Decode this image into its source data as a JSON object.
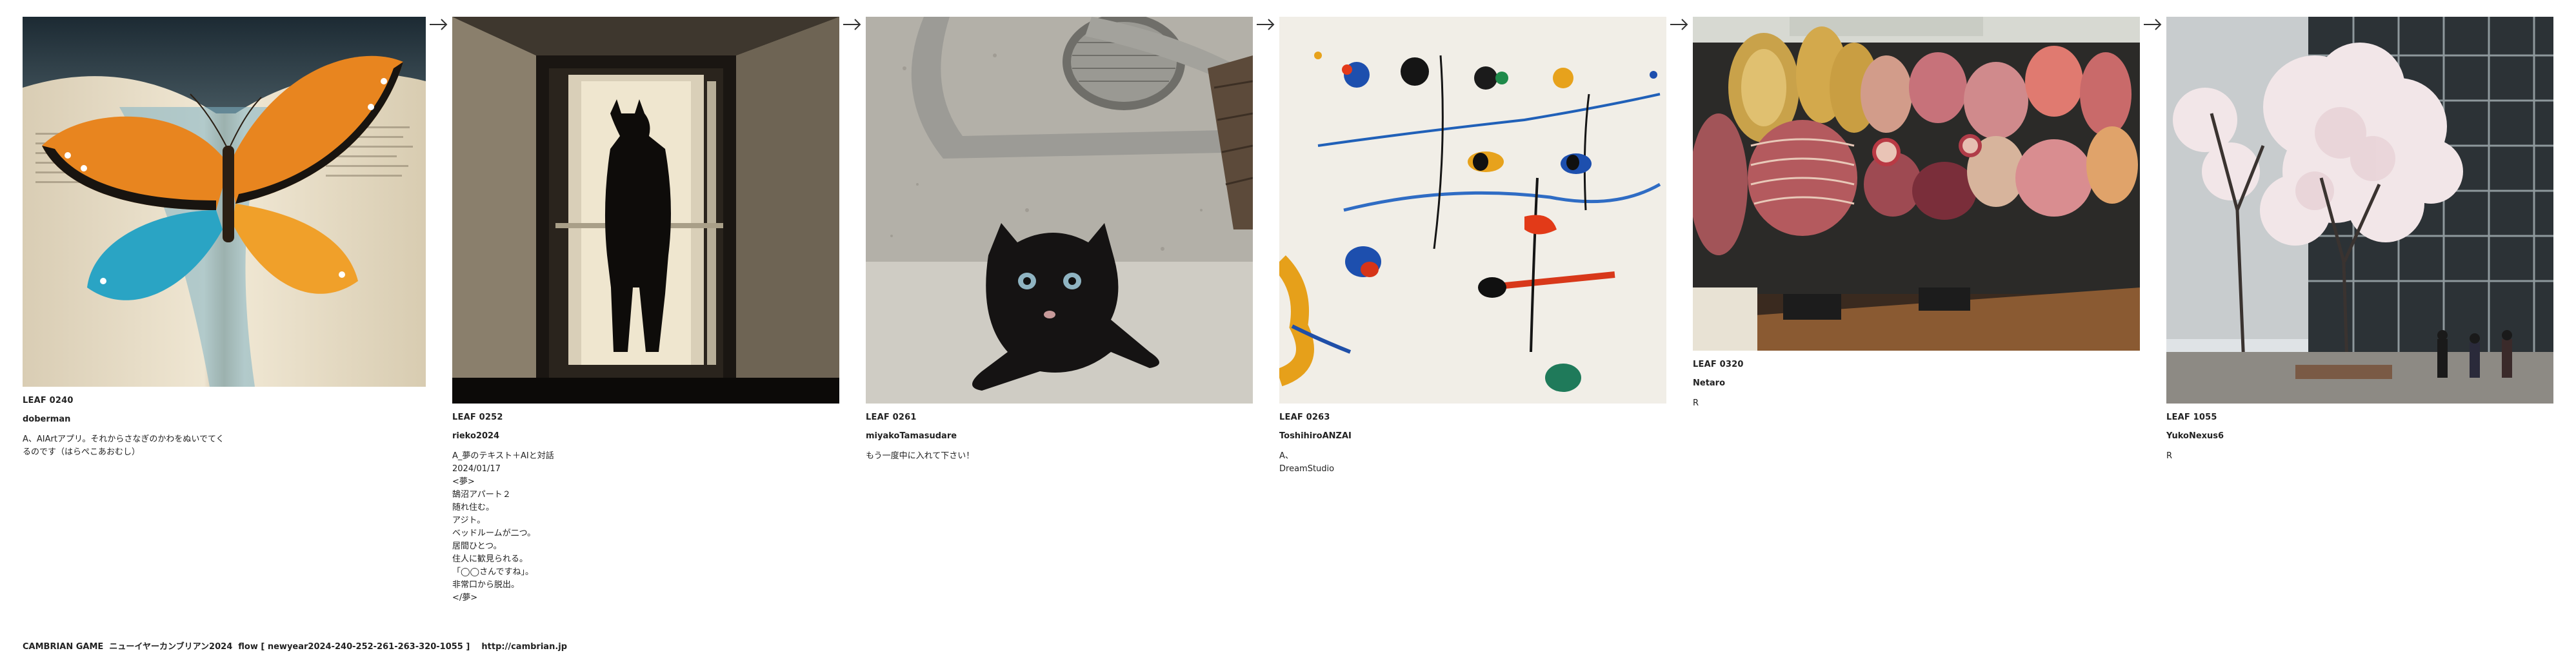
{
  "leaves": [
    {
      "id_label": "LEAF 0240",
      "user": "doberman",
      "text": "A、AIArtアプリ。それからさなぎのかわをぬいでてく\nるのです（はらぺこあおむし）"
    },
    {
      "id_label": "LEAF 0252",
      "user": "rieko2024",
      "text": "A_夢のテキスト＋AIと対話\n2024/01/17\n<夢>\n鵠沼アパート２\n随れ住む。\nアジト。\nベッドルームが二つ。\n居間ひとつ。\n住人に歓見られる。\n「◯◯さんですね」。\n非常口から脱出。\n</夢>"
    },
    {
      "id_label": "LEAF 0261",
      "user": "miyakoTamasudare",
      "text": "もう一度中に入れて下さい！"
    },
    {
      "id_label": "LEAF 0263",
      "user": "ToshihiroANZAI",
      "text": "A、\nDreamStudio"
    },
    {
      "id_label": "LEAF 0320",
      "user": "Netaro",
      "text": "R"
    },
    {
      "id_label": "LEAF 1055",
      "user": "YukoNexus6",
      "text": "R"
    }
  ],
  "arrow_glyph": "→",
  "footer": "CAMBRIAN GAME  ニューイヤーカンブリアン2024  flow [ newyear2024-240-252-261-263-320-1055 ]    http://cambrian.jp",
  "icons": [
    "butterfly-image",
    "silhouette-figure-image",
    "black-kitten-image",
    "abstract-paint-image",
    "cured-meats-image",
    "cherry-blossom-street-image",
    "right-arrow-icon"
  ]
}
